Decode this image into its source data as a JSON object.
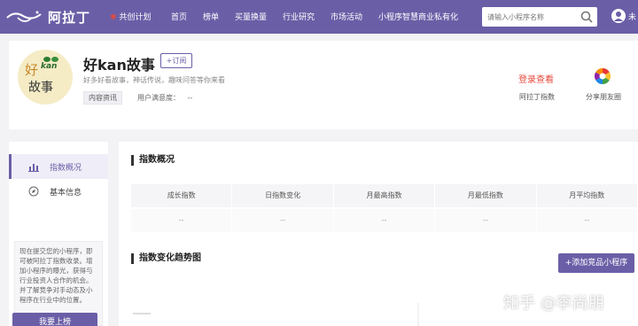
{
  "brand": {
    "name": "阿拉丁"
  },
  "nav": {
    "items": [
      {
        "label": "共创计划"
      },
      {
        "label": "首页"
      },
      {
        "label": "榜单"
      },
      {
        "label": "买量换量"
      },
      {
        "label": "行业研究"
      },
      {
        "label": "市场活动"
      },
      {
        "label": "小程序智慧商业私有化"
      }
    ]
  },
  "search": {
    "placeholder": "请输入小程序名称"
  },
  "user": {
    "label": "未"
  },
  "app": {
    "logo_text_top": "好",
    "logo_text_bottom": "故事",
    "logo_text_badge": "kan",
    "title": "好kan故事",
    "subscribe_label": "+订阅",
    "description": "好多好看故事，神话传说，趣味问答等你来看",
    "tag": "内容资讯",
    "satisfaction_label": "用户满意度：",
    "satisfaction_value": "--",
    "login_label": "登录查看",
    "index_label": "阿拉丁指数",
    "share_label": "分享朋友圈"
  },
  "sidebar": {
    "items": [
      {
        "label": "指数概况"
      },
      {
        "label": "基本信息"
      }
    ],
    "promo_text": "现在提交您的小程序，即可被阿拉丁指数收录。增加小程序的曝光，获得与行业投资人合作的机会。并了解竞争对手动态及小程序在行业中的位置。",
    "promo_button": "我要上榜"
  },
  "overview": {
    "title": "指数概况",
    "columns": [
      "成长指数",
      "日指数变化",
      "月最高指数",
      "月最低指数",
      "月平均指数"
    ],
    "values": [
      "--",
      "--",
      "--",
      "--",
      "--"
    ]
  },
  "trend": {
    "title": "指数变化趋势图",
    "add_button": "+添加竞品小程序"
  },
  "watermark": "知乎 @李尚朋",
  "colors": {
    "brand": "#6a5fa7",
    "accent_red": "#e64a3c"
  }
}
